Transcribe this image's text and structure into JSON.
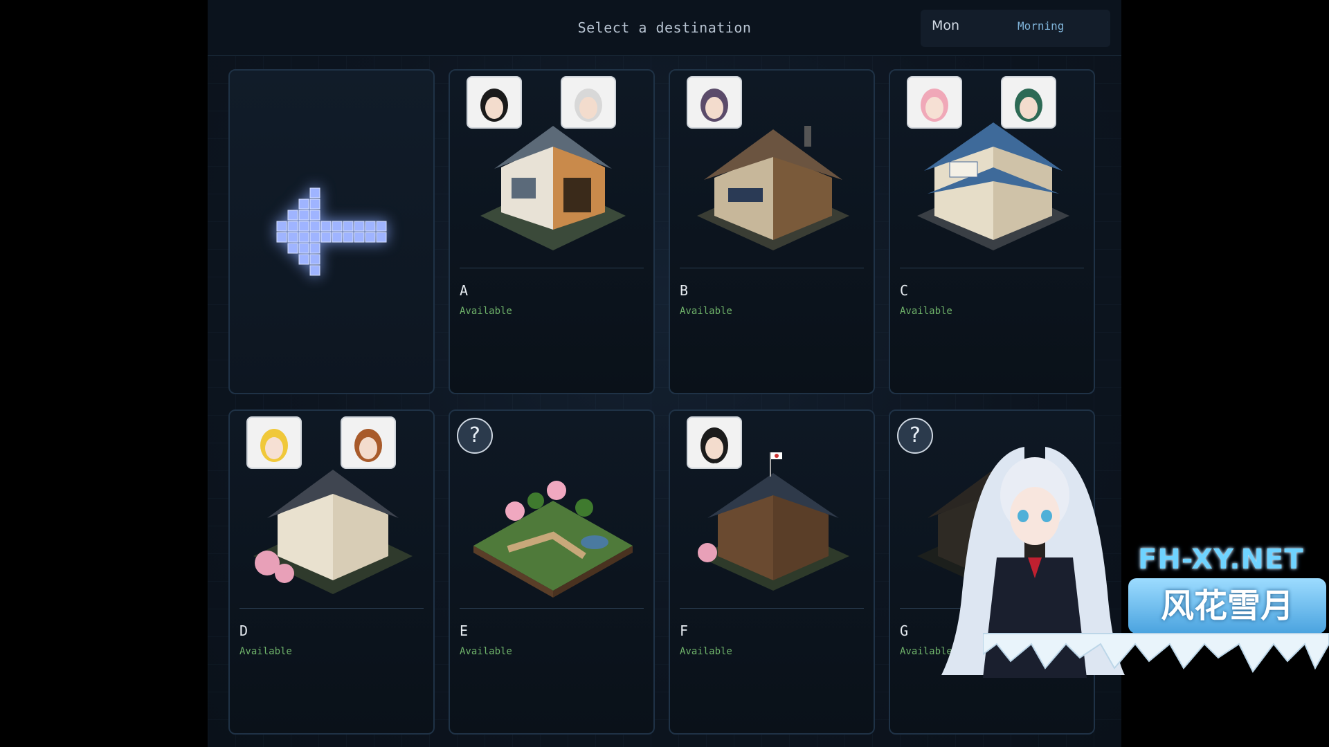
{
  "header": {
    "title": "Select a destination",
    "day": "Mon",
    "period": "Morning"
  },
  "back_button": {
    "icon": "arrow-left-icon"
  },
  "destinations": [
    {
      "name": "A",
      "status": "Available",
      "portraits": 2,
      "unknown": false
    },
    {
      "name": "B",
      "status": "Available",
      "portraits": 1,
      "unknown": false
    },
    {
      "name": "C",
      "status": "Available",
      "portraits": 2,
      "unknown": false
    },
    {
      "name": "D",
      "status": "Available",
      "portraits": 2,
      "unknown": false
    },
    {
      "name": "E",
      "status": "Available",
      "portraits": 0,
      "unknown": true,
      "unknown_label": "?"
    },
    {
      "name": "F",
      "status": "Available",
      "portraits": 1,
      "unknown": false
    },
    {
      "name": "G",
      "status": "Available",
      "portraits": 0,
      "unknown": true,
      "unknown_label": "?"
    }
  ],
  "watermark": {
    "site": "FH-XY.NET",
    "name": "风花雪月"
  },
  "colors": {
    "available": "#6fb36a",
    "accent": "#7fb3d8",
    "arrow": "#a8b8ff"
  }
}
